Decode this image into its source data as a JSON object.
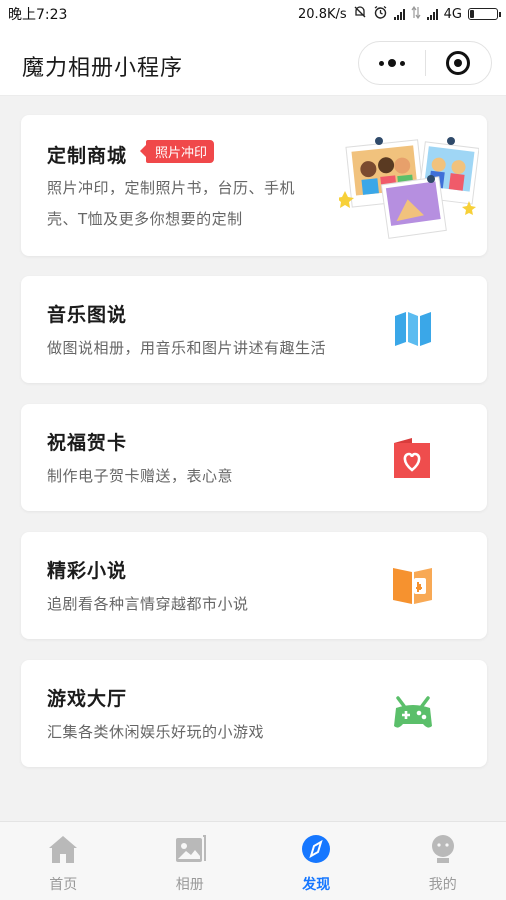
{
  "status_bar": {
    "time": "晚上7:23",
    "speed": "20.8K/s",
    "network": "4G"
  },
  "nav": {
    "title": "魔力相册小程序"
  },
  "cards": [
    {
      "title": "定制商城",
      "badge": "照片冲印",
      "desc_line1": "照片冲印，定制照片书，台历、手机",
      "desc_line2": "壳、T恤及更多你想要的定制",
      "icon": "photo-collage-icon"
    },
    {
      "title": "音乐图说",
      "desc": "做图说相册，用音乐和图片讲述有趣生活",
      "icon": "map-fold-icon",
      "color": "#3aa7e8"
    },
    {
      "title": "祝福贺卡",
      "desc": "制作电子贺卡赠送，表心意",
      "icon": "heart-card-icon",
      "color": "#ef4d4d"
    },
    {
      "title": "精彩小说",
      "desc": "追剧看各种言情穿越都市小说",
      "icon": "open-book-icon",
      "color": "#f6922f"
    },
    {
      "title": "游戏大厅",
      "desc": "汇集各类休闲娱乐好玩的小游戏",
      "icon": "gamepad-icon",
      "color": "#5bbf6a"
    }
  ],
  "tabs": [
    {
      "label": "首页",
      "icon": "home-icon",
      "active": false
    },
    {
      "label": "相册",
      "icon": "album-icon",
      "active": false
    },
    {
      "label": "发现",
      "icon": "compass-icon",
      "active": true
    },
    {
      "label": "我的",
      "icon": "profile-icon",
      "active": false
    }
  ],
  "colors": {
    "accent": "#1677ff",
    "badge": "#f0484a",
    "background": "#f2f2f2"
  }
}
